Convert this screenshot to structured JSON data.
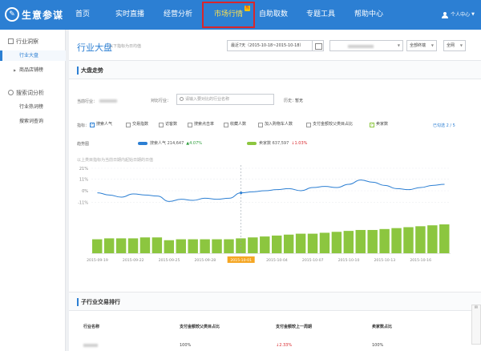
{
  "app": {
    "logo_text": "生意参谋"
  },
  "nav": {
    "items": [
      {
        "label": "首页"
      },
      {
        "label": "实时直播"
      },
      {
        "label": "经营分析"
      },
      {
        "label": "市场行情",
        "active": true,
        "badge": "热"
      },
      {
        "label": "自助取数"
      },
      {
        "label": "专题工具"
      },
      {
        "label": "帮助中心"
      }
    ],
    "user_label": "个人中心"
  },
  "sidebar": {
    "group1": "行业洞察",
    "item_industry": "行业大盘",
    "item_shop": "商品店铺榜",
    "group2": "搜索词分析",
    "item_hotwords": "行业热词榜",
    "item_search": "搜索词查询"
  },
  "header": {
    "title": "行业大盘",
    "subtitle": "以下指标为日均值",
    "date_range": "最近7天（2015-10-18~2015-10-18）",
    "terminal": "全部终端",
    "platform": "全网"
  },
  "section_trend": {
    "title": "大盘走势",
    "current_industry_label": "当前行业：",
    "compare_label": "对比行业：",
    "compare_placeholder": "请输入要对比的行业名称",
    "history_label": "历史：",
    "history_value": "暂无",
    "metrics_label": "指标：",
    "metrics": [
      {
        "label": "搜索人气",
        "checked": true
      },
      {
        "label": "交易指数",
        "checked": false
      },
      {
        "label": "访客数",
        "checked": false
      },
      {
        "label": "搜索点击率",
        "checked": false
      },
      {
        "label": "收藏人数",
        "checked": false
      },
      {
        "label": "加入购物车人数",
        "checked": false
      },
      {
        "label": "支付金额较父类目占比",
        "checked": false
      },
      {
        "label": "卖家数",
        "checked": true,
        "green": true
      }
    ],
    "metrics_selected": "已勾选 2 / 5",
    "trend_legend_label": "趋势图",
    "chart_note": "以上类目指标为当前日期内起始日期的日值",
    "legend": [
      {
        "name": "搜索人气",
        "value": "214,647",
        "change": "4.07%",
        "direction": "up",
        "color": "#2c7fd3"
      },
      {
        "name": "卖家数",
        "value": "637,597",
        "change": "1.03%",
        "direction": "down",
        "color": "#8cc63f"
      }
    ]
  },
  "chart_data": {
    "type": "line",
    "x": [
      "2015-09-19",
      "2015-09-20",
      "2015-09-21",
      "2015-09-22",
      "2015-09-23",
      "2015-09-24",
      "2015-09-25",
      "2015-09-26",
      "2015-09-27",
      "2015-09-28",
      "2015-09-29",
      "2015-09-30",
      "2015-10-01",
      "2015-10-02",
      "2015-10-03",
      "2015-10-04",
      "2015-10-05",
      "2015-10-06",
      "2015-10-07",
      "2015-10-08",
      "2015-10-09",
      "2015-10-10",
      "2015-10-11",
      "2015-10-12",
      "2015-10-13",
      "2015-10-14",
      "2015-10-15",
      "2015-10-16",
      "2015-10-17",
      "2015-10-18"
    ],
    "xticks": [
      "2015-09-19",
      "2015-09-22",
      "2015-09-25",
      "2015-09-28",
      "2015-10-01",
      "2015-10-04",
      "2015-10-07",
      "2015-10-10",
      "2015-10-13",
      "2015-10-16"
    ],
    "highlight_x": "2015-10-01",
    "y_ticks": [
      "21%",
      "11%",
      "0%",
      "-11%"
    ],
    "ylim": [
      -21,
      21
    ],
    "series": [
      {
        "name": "搜索人气",
        "kind": "line",
        "color": "#2c7fd3",
        "values": [
          -2,
          -4,
          -6,
          -3,
          -4,
          -5,
          -10,
          -8,
          -9,
          -7,
          -8,
          -7,
          -2,
          -1,
          0,
          1,
          2,
          0,
          3,
          4,
          3,
          6,
          10,
          8,
          5,
          2,
          1,
          3,
          5,
          6
        ]
      },
      {
        "name": "卖家数",
        "kind": "bar",
        "color": "#8cc63f",
        "values": [
          15,
          16,
          16,
          16,
          17,
          17,
          14,
          15,
          15,
          15,
          15,
          15,
          16,
          17,
          18,
          19,
          20,
          21,
          21,
          22,
          23,
          24,
          25,
          25,
          26,
          27,
          28,
          29,
          30,
          31
        ]
      }
    ]
  },
  "section_rank": {
    "title": "子行业交易排行",
    "columns": [
      "行业名称",
      "支付金额较父类目占比",
      "支付金额较上一周期",
      "卖家数占比"
    ],
    "row": [
      "",
      "100%",
      "2.33%",
      "100%"
    ]
  }
}
